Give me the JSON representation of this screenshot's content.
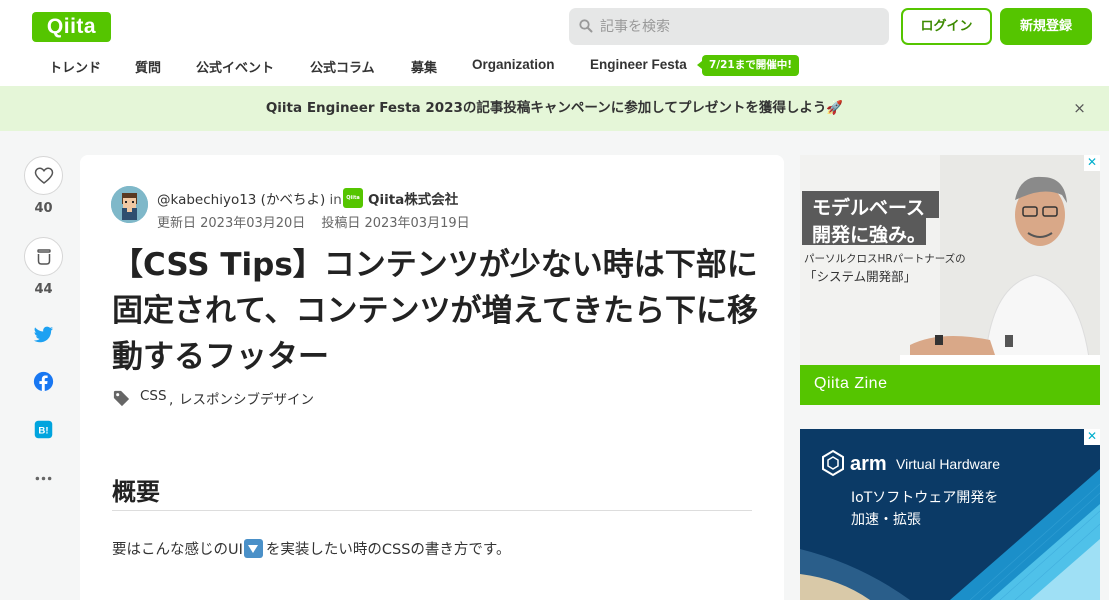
{
  "header": {
    "logo": "Qiita",
    "search_placeholder": "記事を検索",
    "login_label": "ログイン",
    "signup_label": "新規登録"
  },
  "nav": {
    "items": [
      "トレンド",
      "質問",
      "公式イベント",
      "公式コラム",
      "募集",
      "Organization",
      "Engineer Festa"
    ],
    "badge": "7/21まで開催中!"
  },
  "banner": {
    "text": "Qiita Engineer Festa 2023の記事投稿キャンペーンに参加してプレゼントを獲得しよう🚀",
    "close": "×"
  },
  "actions": {
    "like_count": "40",
    "stock_count": "44"
  },
  "article": {
    "author": "@kabechiyo13 (かべちよ)",
    "in_text": "in",
    "org_logo_text": "Qiita",
    "org_name": "Qiita株式会社",
    "updated": "更新日 2023年03月20日",
    "posted": "投稿日 2023年03月19日",
    "title": "【CSS Tips】コンテンツが少ない時は下部に固定されて、コンテンツが増えてきたら下に移動するフッター",
    "tags": [
      "CSS",
      "レスポンシブデザイン"
    ],
    "tag_separator": ",",
    "heading": "概要",
    "para_before": "要はこんな感じのUI",
    "para_after": "を実装したい時のCSSの書き方です。"
  },
  "ads": {
    "ad1": {
      "line1": "モデルベース",
      "line2": "開発に強み。",
      "line3": "パーソルクロスHRパートナーズの",
      "line4": "「システム開発部」",
      "brand": "Qiita Zine"
    },
    "ad2": {
      "brand": "arm",
      "product": "Virtual Hardware",
      "line1": "IoTソフトウェア開発を",
      "line2": "加速・拡張"
    },
    "close": "✕"
  },
  "colors": {
    "brand_green": "#55c500",
    "banner_bg": "#e5f6d8",
    "page_bg": "#f5f6f6",
    "twitter": "#1da1f2",
    "facebook": "#1877f2",
    "hatena": "#00a4de"
  }
}
